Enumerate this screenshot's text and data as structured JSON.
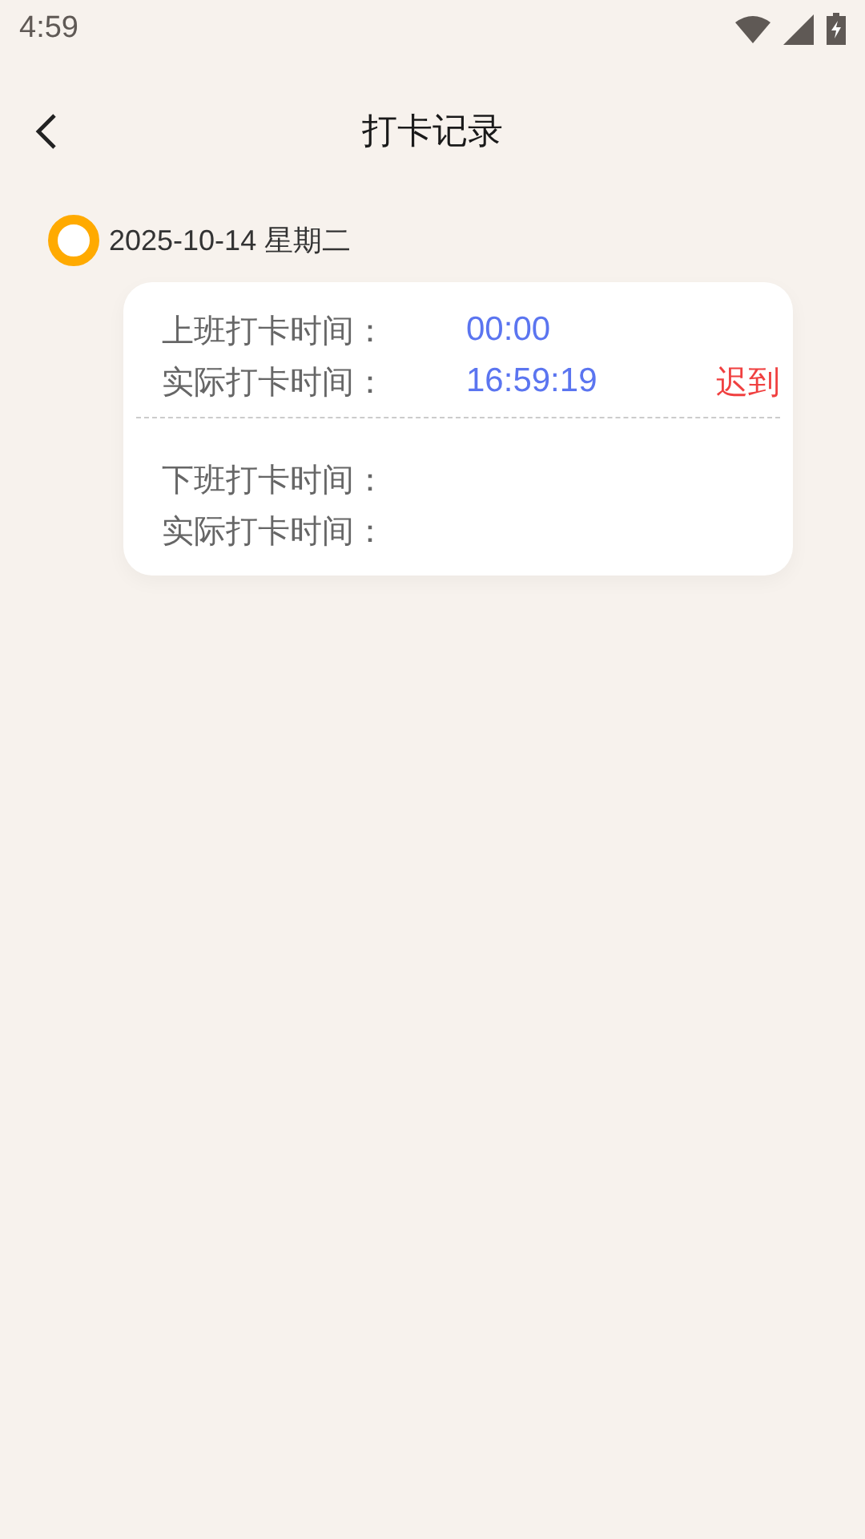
{
  "status_bar": {
    "time": "4:59"
  },
  "header": {
    "title": "打卡记录"
  },
  "records": [
    {
      "date": "2025-10-14 星期二",
      "sections": [
        {
          "rows": [
            {
              "label": "上班打卡时间：",
              "value": "00:00"
            },
            {
              "label": "实际打卡时间：",
              "value": "16:59:19",
              "tag": "迟到"
            }
          ]
        },
        {
          "rows": [
            {
              "label": "下班打卡时间："
            },
            {
              "label": "实际打卡时间："
            }
          ]
        }
      ]
    }
  ]
}
